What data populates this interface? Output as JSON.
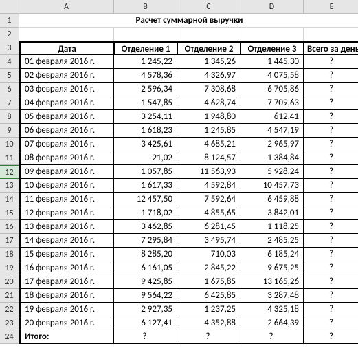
{
  "columns": [
    "A",
    "B",
    "C",
    "D",
    "E"
  ],
  "title": "Расчет суммарной выручки",
  "headers": {
    "date": "Дата",
    "d1": "Отделение 1",
    "d2": "Отделение 2",
    "d3": "Отделение 3",
    "total": "Всего за день"
  },
  "rows": [
    {
      "date": "01 февраля 2016 г.",
      "d1": "1 245,22",
      "d2": "1 345,26",
      "d3": "1 445,30",
      "total": "?"
    },
    {
      "date": "02 февраля 2016 г.",
      "d1": "4 578,36",
      "d2": "4 326,97",
      "d3": "4 075,58",
      "total": "?"
    },
    {
      "date": "03 февраля 2016 г.",
      "d1": "2 596,34",
      "d2": "7 308,68",
      "d3": "6 705,86",
      "total": "?"
    },
    {
      "date": "04 февраля 2016 г.",
      "d1": "1 547,85",
      "d2": "4 628,74",
      "d3": "7 709,63",
      "total": "?"
    },
    {
      "date": "05 февраля 2016 г.",
      "d1": "3 254,11",
      "d2": "1 948,80",
      "d3": "612,41",
      "total": "?"
    },
    {
      "date": "06 февраля 2016 г.",
      "d1": "1 618,23",
      "d2": "1 245,85",
      "d3": "4 547,19",
      "total": "?"
    },
    {
      "date": "07 февраля 2016 г.",
      "d1": "3 425,61",
      "d2": "4 685,21",
      "d3": "2 965,97",
      "total": "?"
    },
    {
      "date": "08 февраля 2016 г.",
      "d1": "21,02",
      "d2": "8 124,57",
      "d3": "1 384,84",
      "total": "?"
    },
    {
      "date": "09 февраля 2016 г.",
      "d1": "1 057,85",
      "d2": "11 563,93",
      "d3": "5 928,24",
      "total": "?"
    },
    {
      "date": "10 февраля 2016 г.",
      "d1": "1 617,33",
      "d2": "4 592,84",
      "d3": "10 457,73",
      "total": "?"
    },
    {
      "date": "11 февраля 2016 г.",
      "d1": "12 457,50",
      "d2": "7 592,64",
      "d3": "6 459,88",
      "total": "?"
    },
    {
      "date": "12 февраля 2016 г.",
      "d1": "1 718,02",
      "d2": "4 855,65",
      "d3": "3 842,01",
      "total": "?"
    },
    {
      "date": "13 февраля 2016 г.",
      "d1": "3 462,85",
      "d2": "6 281,45",
      "d3": "1 118,25",
      "total": "?"
    },
    {
      "date": "14 февраля 2016 г.",
      "d1": "7 295,84",
      "d2": "3 495,74",
      "d3": "2 485,25",
      "total": "?"
    },
    {
      "date": "15 февраля 2016 г.",
      "d1": "8 285,20",
      "d2": "710,03",
      "d3": "6 185,24",
      "total": "?"
    },
    {
      "date": "16 февраля 2016 г.",
      "d1": "6 161,05",
      "d2": "2 845,22",
      "d3": "9 675,25",
      "total": "?"
    },
    {
      "date": "17 февраля 2016 г.",
      "d1": "9 425,85",
      "d2": "1 675,85",
      "d3": "13 165,26",
      "total": "?"
    },
    {
      "date": "18 февраля 2016 г.",
      "d1": "9 564,22",
      "d2": "6 425,85",
      "d3": "3 287,48",
      "total": "?"
    },
    {
      "date": "19 февраля 2016 г.",
      "d1": "2 927,35",
      "d2": "1 237,25",
      "d3": "4 325,18",
      "total": "?"
    },
    {
      "date": "20 февраля 2016 г.",
      "d1": "6 127,41",
      "d2": "4 352,88",
      "d3": "2 664,39",
      "total": "?"
    }
  ],
  "footer": {
    "label": "Итого:",
    "d1": "?",
    "d2": "?",
    "d3": "?",
    "total": "?"
  },
  "selected_row_index": 8,
  "chart_data": {
    "type": "table",
    "title": "Расчет суммарной выручки",
    "columns": [
      "Дата",
      "Отделение 1",
      "Отделение 2",
      "Отделение 3",
      "Всего за день"
    ],
    "records": [
      [
        "01 февраля 2016 г.",
        1245.22,
        1345.26,
        1445.3,
        null
      ],
      [
        "02 февраля 2016 г.",
        4578.36,
        4326.97,
        4075.58,
        null
      ],
      [
        "03 февраля 2016 г.",
        2596.34,
        7308.68,
        6705.86,
        null
      ],
      [
        "04 февраля 2016 г.",
        1547.85,
        4628.74,
        7709.63,
        null
      ],
      [
        "05 февраля 2016 г.",
        3254.11,
        1948.8,
        612.41,
        null
      ],
      [
        "06 февраля 2016 г.",
        1618.23,
        1245.85,
        4547.19,
        null
      ],
      [
        "07 февраля 2016 г.",
        3425.61,
        4685.21,
        2965.97,
        null
      ],
      [
        "08 февраля 2016 г.",
        21.02,
        8124.57,
        1384.84,
        null
      ],
      [
        "09 февраля 2016 г.",
        1057.85,
        11563.93,
        5928.24,
        null
      ],
      [
        "10 февраля 2016 г.",
        1617.33,
        4592.84,
        10457.73,
        null
      ],
      [
        "11 февраля 2016 г.",
        12457.5,
        7592.64,
        6459.88,
        null
      ],
      [
        "12 февраля 2016 г.",
        1718.02,
        4855.65,
        3842.01,
        null
      ],
      [
        "13 февраля 2016 г.",
        3462.85,
        6281.45,
        1118.25,
        null
      ],
      [
        "14 февраля 2016 г.",
        7295.84,
        3495.74,
        2485.25,
        null
      ],
      [
        "15 февраля 2016 г.",
        8285.2,
        710.03,
        6185.24,
        null
      ],
      [
        "16 февраля 2016 г.",
        6161.05,
        2845.22,
        9675.25,
        null
      ],
      [
        "17 февраля 2016 г.",
        9425.85,
        1675.85,
        13165.26,
        null
      ],
      [
        "18 февраля 2016 г.",
        9564.22,
        6425.85,
        3287.48,
        null
      ],
      [
        "19 февраля 2016 г.",
        2927.35,
        1237.25,
        4325.18,
        null
      ],
      [
        "20 февраля 2016 г.",
        6127.41,
        4352.88,
        2664.39,
        null
      ]
    ]
  }
}
